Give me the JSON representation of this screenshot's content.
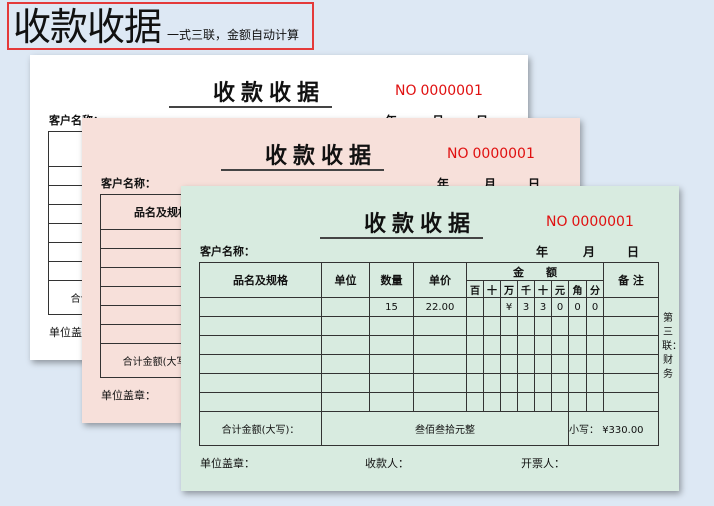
{
  "banner": {
    "title": "收款收据",
    "subtitle": "一式三联，金额自动计算"
  },
  "colors": {
    "white_card": "#ffffff",
    "pink_card": "#f7e0da",
    "green_card": "#d8ebe0",
    "number": "#e01010",
    "banner_border": "#e43a3a"
  },
  "receipt": {
    "title": "收款收据",
    "no_label": "NO",
    "number": "0000001",
    "customer_label": "客户名称：",
    "year": "年",
    "month": "月",
    "day": "日",
    "headers": {
      "item": "品名及规格",
      "unit": "单位",
      "qty": "数量",
      "price": "单价",
      "amount": "金　　额",
      "note": "备 注"
    },
    "digit_headers": [
      "百",
      "十",
      "万",
      "千",
      "十",
      "元",
      "角",
      "分"
    ],
    "rows": [
      {
        "item": "",
        "unit": "",
        "qty": "15",
        "price": "22.00",
        "digits": [
          "",
          "",
          "¥",
          "3",
          "3",
          "0",
          "0",
          "0"
        ],
        "note": ""
      },
      {
        "item": "",
        "unit": "",
        "qty": "",
        "price": "",
        "digits": [
          "",
          "",
          "",
          "",
          "",
          "",
          "",
          ""
        ],
        "note": ""
      },
      {
        "item": "",
        "unit": "",
        "qty": "",
        "price": "",
        "digits": [
          "",
          "",
          "",
          "",
          "",
          "",
          "",
          ""
        ],
        "note": ""
      },
      {
        "item": "",
        "unit": "",
        "qty": "",
        "price": "",
        "digits": [
          "",
          "",
          "",
          "",
          "",
          "",
          "",
          ""
        ],
        "note": ""
      },
      {
        "item": "",
        "unit": "",
        "qty": "",
        "price": "",
        "digits": [
          "",
          "",
          "",
          "",
          "",
          "",
          "",
          ""
        ],
        "note": ""
      },
      {
        "item": "",
        "unit": "",
        "qty": "",
        "price": "",
        "digits": [
          "",
          "",
          "",
          "",
          "",
          "",
          "",
          ""
        ],
        "note": ""
      }
    ],
    "total_label": "合计金额(大写)：",
    "total_words": "叁佰叁拾元整",
    "small_label": "小写：",
    "small_value": "¥330.00",
    "stamp_label": "单位盖章：",
    "payee_label": "收款人：",
    "issuer_label": "开票人：",
    "copy_label": "第三联：财务"
  }
}
